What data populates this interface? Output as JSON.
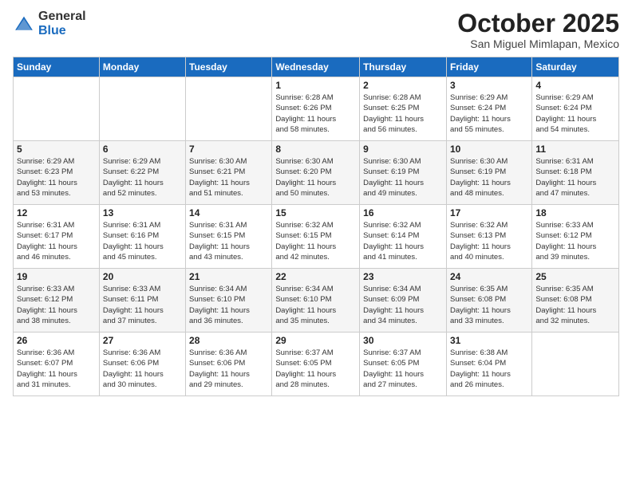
{
  "logo": {
    "general": "General",
    "blue": "Blue"
  },
  "header": {
    "month": "October 2025",
    "location": "San Miguel Mimlapan, Mexico"
  },
  "weekdays": [
    "Sunday",
    "Monday",
    "Tuesday",
    "Wednesday",
    "Thursday",
    "Friday",
    "Saturday"
  ],
  "weeks": [
    [
      {
        "day": "",
        "info": ""
      },
      {
        "day": "",
        "info": ""
      },
      {
        "day": "",
        "info": ""
      },
      {
        "day": "1",
        "info": "Sunrise: 6:28 AM\nSunset: 6:26 PM\nDaylight: 11 hours\nand 58 minutes."
      },
      {
        "day": "2",
        "info": "Sunrise: 6:28 AM\nSunset: 6:25 PM\nDaylight: 11 hours\nand 56 minutes."
      },
      {
        "day": "3",
        "info": "Sunrise: 6:29 AM\nSunset: 6:24 PM\nDaylight: 11 hours\nand 55 minutes."
      },
      {
        "day": "4",
        "info": "Sunrise: 6:29 AM\nSunset: 6:24 PM\nDaylight: 11 hours\nand 54 minutes."
      }
    ],
    [
      {
        "day": "5",
        "info": "Sunrise: 6:29 AM\nSunset: 6:23 PM\nDaylight: 11 hours\nand 53 minutes."
      },
      {
        "day": "6",
        "info": "Sunrise: 6:29 AM\nSunset: 6:22 PM\nDaylight: 11 hours\nand 52 minutes."
      },
      {
        "day": "7",
        "info": "Sunrise: 6:30 AM\nSunset: 6:21 PM\nDaylight: 11 hours\nand 51 minutes."
      },
      {
        "day": "8",
        "info": "Sunrise: 6:30 AM\nSunset: 6:20 PM\nDaylight: 11 hours\nand 50 minutes."
      },
      {
        "day": "9",
        "info": "Sunrise: 6:30 AM\nSunset: 6:19 PM\nDaylight: 11 hours\nand 49 minutes."
      },
      {
        "day": "10",
        "info": "Sunrise: 6:30 AM\nSunset: 6:19 PM\nDaylight: 11 hours\nand 48 minutes."
      },
      {
        "day": "11",
        "info": "Sunrise: 6:31 AM\nSunset: 6:18 PM\nDaylight: 11 hours\nand 47 minutes."
      }
    ],
    [
      {
        "day": "12",
        "info": "Sunrise: 6:31 AM\nSunset: 6:17 PM\nDaylight: 11 hours\nand 46 minutes."
      },
      {
        "day": "13",
        "info": "Sunrise: 6:31 AM\nSunset: 6:16 PM\nDaylight: 11 hours\nand 45 minutes."
      },
      {
        "day": "14",
        "info": "Sunrise: 6:31 AM\nSunset: 6:15 PM\nDaylight: 11 hours\nand 43 minutes."
      },
      {
        "day": "15",
        "info": "Sunrise: 6:32 AM\nSunset: 6:15 PM\nDaylight: 11 hours\nand 42 minutes."
      },
      {
        "day": "16",
        "info": "Sunrise: 6:32 AM\nSunset: 6:14 PM\nDaylight: 11 hours\nand 41 minutes."
      },
      {
        "day": "17",
        "info": "Sunrise: 6:32 AM\nSunset: 6:13 PM\nDaylight: 11 hours\nand 40 minutes."
      },
      {
        "day": "18",
        "info": "Sunrise: 6:33 AM\nSunset: 6:12 PM\nDaylight: 11 hours\nand 39 minutes."
      }
    ],
    [
      {
        "day": "19",
        "info": "Sunrise: 6:33 AM\nSunset: 6:12 PM\nDaylight: 11 hours\nand 38 minutes."
      },
      {
        "day": "20",
        "info": "Sunrise: 6:33 AM\nSunset: 6:11 PM\nDaylight: 11 hours\nand 37 minutes."
      },
      {
        "day": "21",
        "info": "Sunrise: 6:34 AM\nSunset: 6:10 PM\nDaylight: 11 hours\nand 36 minutes."
      },
      {
        "day": "22",
        "info": "Sunrise: 6:34 AM\nSunset: 6:10 PM\nDaylight: 11 hours\nand 35 minutes."
      },
      {
        "day": "23",
        "info": "Sunrise: 6:34 AM\nSunset: 6:09 PM\nDaylight: 11 hours\nand 34 minutes."
      },
      {
        "day": "24",
        "info": "Sunrise: 6:35 AM\nSunset: 6:08 PM\nDaylight: 11 hours\nand 33 minutes."
      },
      {
        "day": "25",
        "info": "Sunrise: 6:35 AM\nSunset: 6:08 PM\nDaylight: 11 hours\nand 32 minutes."
      }
    ],
    [
      {
        "day": "26",
        "info": "Sunrise: 6:36 AM\nSunset: 6:07 PM\nDaylight: 11 hours\nand 31 minutes."
      },
      {
        "day": "27",
        "info": "Sunrise: 6:36 AM\nSunset: 6:06 PM\nDaylight: 11 hours\nand 30 minutes."
      },
      {
        "day": "28",
        "info": "Sunrise: 6:36 AM\nSunset: 6:06 PM\nDaylight: 11 hours\nand 29 minutes."
      },
      {
        "day": "29",
        "info": "Sunrise: 6:37 AM\nSunset: 6:05 PM\nDaylight: 11 hours\nand 28 minutes."
      },
      {
        "day": "30",
        "info": "Sunrise: 6:37 AM\nSunset: 6:05 PM\nDaylight: 11 hours\nand 27 minutes."
      },
      {
        "day": "31",
        "info": "Sunrise: 6:38 AM\nSunset: 6:04 PM\nDaylight: 11 hours\nand 26 minutes."
      },
      {
        "day": "",
        "info": ""
      }
    ]
  ]
}
